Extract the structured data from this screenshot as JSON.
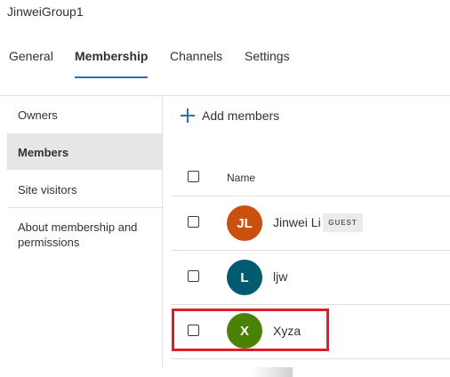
{
  "group_name": "JinweiGroup1",
  "tabs": [
    {
      "label": "General",
      "active": false
    },
    {
      "label": "Membership",
      "active": true
    },
    {
      "label": "Channels",
      "active": false
    },
    {
      "label": "Settings",
      "active": false
    }
  ],
  "sidebar": {
    "items": [
      {
        "label": "Owners",
        "selected": false
      },
      {
        "label": "Members",
        "selected": true
      },
      {
        "label": "Site visitors",
        "selected": false
      },
      {
        "label": "About membership and permissions",
        "selected": false
      }
    ]
  },
  "toolbar": {
    "add_members_label": "Add members",
    "add_icon": "plus-icon"
  },
  "table": {
    "name_header": "Name"
  },
  "members": [
    {
      "initials": "JL",
      "name": "Jinwei Li",
      "badge": "GUEST",
      "avatar_color": "#ca5010"
    },
    {
      "initials": "L",
      "name": "ljw",
      "badge": "",
      "avatar_color": "#005b70"
    },
    {
      "initials": "X",
      "name": "Xyza",
      "badge": "",
      "avatar_color": "#498205",
      "highlighted": true
    }
  ],
  "colors": {
    "accent": "#2b6fb5",
    "highlight": "#e21d2b",
    "selected_bg": "#e6e6e6"
  }
}
